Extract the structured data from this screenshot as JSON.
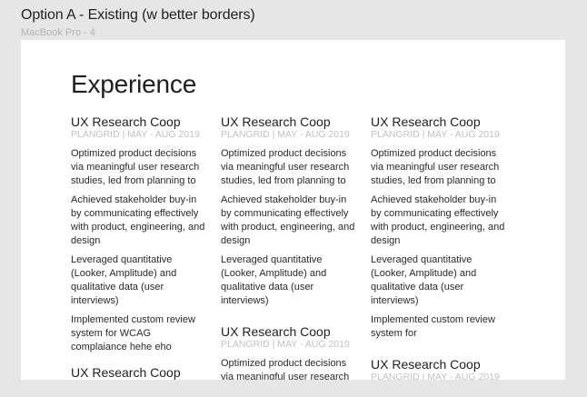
{
  "frame": {
    "title": "Option A - Existing (w better borders)",
    "subtitle": "MacBook Pro - 4"
  },
  "page": {
    "heading": "Experience"
  },
  "columns": [
    {
      "jobs": [
        {
          "title": "UX Research Coop",
          "meta": "PLANGRID | MAY - AUG 2019",
          "bullets": [
            "Optimized product decisions via meaningful user research studies, led from planning to",
            "Achieved stakeholder buy-in by communicating effectively with product, engineering, and design",
            "Leveraged quantitative (Looker, Amplitude) and qualitative data  (user interviews)",
            "Implemented custom review system for WCAG complaiance hehe eho"
          ]
        },
        {
          "title": "UX Research Coop",
          "meta": "",
          "bullets": []
        }
      ]
    },
    {
      "jobs": [
        {
          "title": "UX Research Coop",
          "meta": "PLANGRID | MAY - AUG 2019",
          "bullets": [
            "Optimized product decisions via meaningful user research studies, led from planning to",
            "Achieved stakeholder buy-in by communicating effectively with product, engineering, and design",
            "Leveraged quantitative (Looker, Amplitude) and qualitative data  (user interviews)"
          ]
        },
        {
          "title": "UX Research Coop",
          "meta": "PLANGRID | MAY - AUG 2019",
          "bullets": [
            "Optimized product decisions via meaningful user research"
          ]
        }
      ]
    },
    {
      "jobs": [
        {
          "title": "UX Research Coop",
          "meta": "PLANGRID | MAY - AUG 2019",
          "bullets": [
            "Optimized product decisions via meaningful user research studies, led from planning to",
            "Achieved stakeholder buy-in by communicating effectively with product, engineering, and design",
            "Leveraged quantitative (Looker, Amplitude) and qualitative data  (user interviews)",
            "Implemented custom review system for"
          ]
        },
        {
          "title": "UX Research Coop",
          "meta": "PLANGRID | MAY - AUG 2019",
          "bullets": []
        }
      ]
    }
  ]
}
